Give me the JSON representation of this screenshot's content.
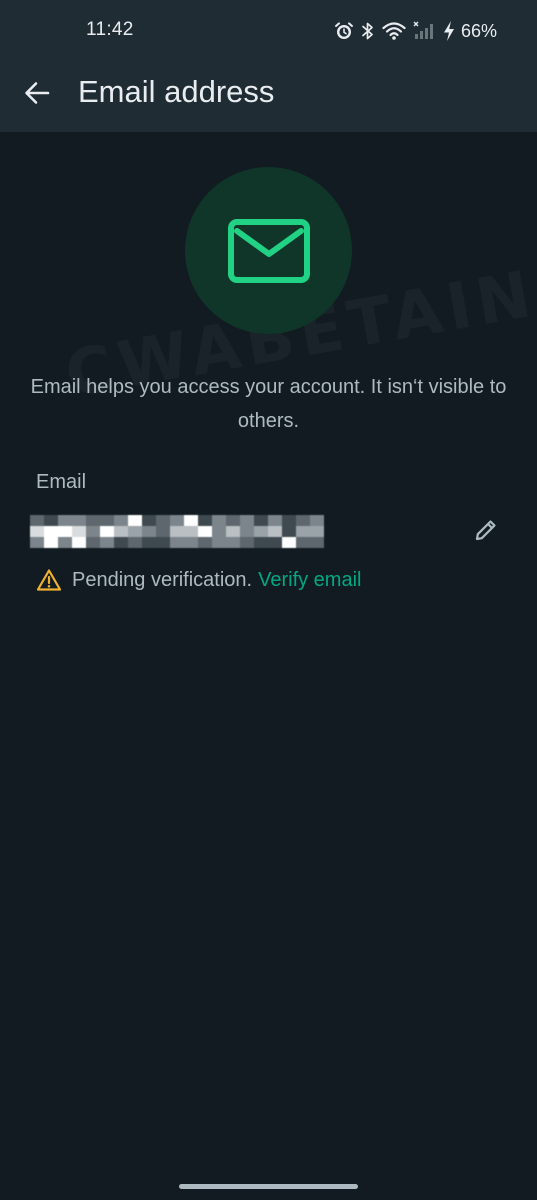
{
  "status_bar": {
    "time": "11:42",
    "battery": "66%",
    "icons": [
      "alarm-icon",
      "bluetooth-icon",
      "wifi-icon",
      "no-signal-icon",
      "charging-icon"
    ]
  },
  "app_bar": {
    "title": "Email address",
    "back_icon": "arrow-left-icon"
  },
  "hero": {
    "icon": "envelope-icon"
  },
  "description": "Email helps you access your account. It isn‘t visible to others.",
  "email": {
    "label": "Email",
    "edit_icon": "pencil-icon"
  },
  "verification": {
    "status_text": "Pending verification.",
    "action_label": "Verify email",
    "warning_icon": "warning-icon"
  },
  "watermark": "CWABETAINFO",
  "colors": {
    "background": "#111b21",
    "app_bar": "#1f2c34",
    "accent": "#00a884",
    "hero_circle": "#103629",
    "warning": "#f0b030",
    "secondary_text": "#aebac1",
    "primary_text": "#e9edef"
  }
}
